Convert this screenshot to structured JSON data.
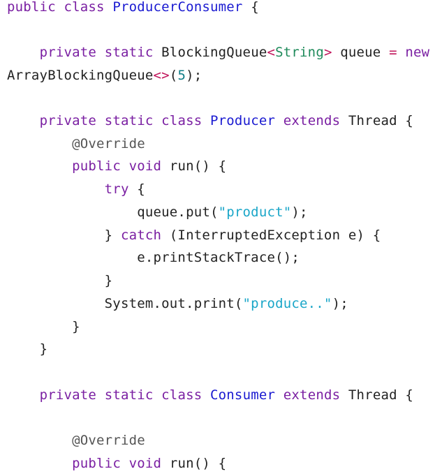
{
  "code": {
    "l1": {
      "kw1": "public",
      "kw2": "class",
      "name": "ProducerConsumer",
      "brace": "{"
    },
    "l3": {
      "kw1": "private",
      "kw2": "static",
      "type": "BlockingQueue",
      "lt": "<",
      "generic": "String",
      "gt": ">",
      "var": "queue",
      "eq": "=",
      "kw3": "new"
    },
    "l4": {
      "type": "ArrayBlockingQueue",
      "diamond": "<>",
      "open": "(",
      "num": "5",
      "close": ");"
    },
    "l6": {
      "kw1": "private",
      "kw2": "static",
      "kw3": "class",
      "name": "Producer",
      "kw4": "extends",
      "parent": "Thread",
      "brace": "{"
    },
    "l7": {
      "anno": "@Override"
    },
    "l8": {
      "kw1": "public",
      "kw2": "void",
      "sig": "run() {"
    },
    "l9": {
      "kw1": "try",
      "brace": "{"
    },
    "l10": {
      "pre": "queue.put(",
      "str": "\"product\"",
      "post": ");"
    },
    "l11": {
      "pre": "}",
      "kw1": "catch",
      "post": "(InterruptedException e) {"
    },
    "l12": {
      "text": "e.printStackTrace();"
    },
    "l13": {
      "text": "}"
    },
    "l14": {
      "pre": "System.out.print(",
      "str": "\"produce..\"",
      "post": ");"
    },
    "l15": {
      "text": "}"
    },
    "l16": {
      "text": "}"
    },
    "l18": {
      "kw1": "private",
      "kw2": "static",
      "kw3": "class",
      "name": "Consumer",
      "kw4": "extends",
      "parent": "Thread",
      "brace": "{"
    },
    "l20": {
      "anno": "@Override"
    },
    "l21": {
      "kw1": "public",
      "kw2": "void",
      "sig": "run() {"
    }
  },
  "colors": {
    "keyword": "#7a1fa2",
    "class_name": "#1a1ad1",
    "generic_type": "#1e8a5a",
    "operator": "#c0145a",
    "number": "#0e7c86",
    "string": "#1aa6c8",
    "annotation": "#555555",
    "text": "#222222",
    "background": "#ffffff"
  }
}
